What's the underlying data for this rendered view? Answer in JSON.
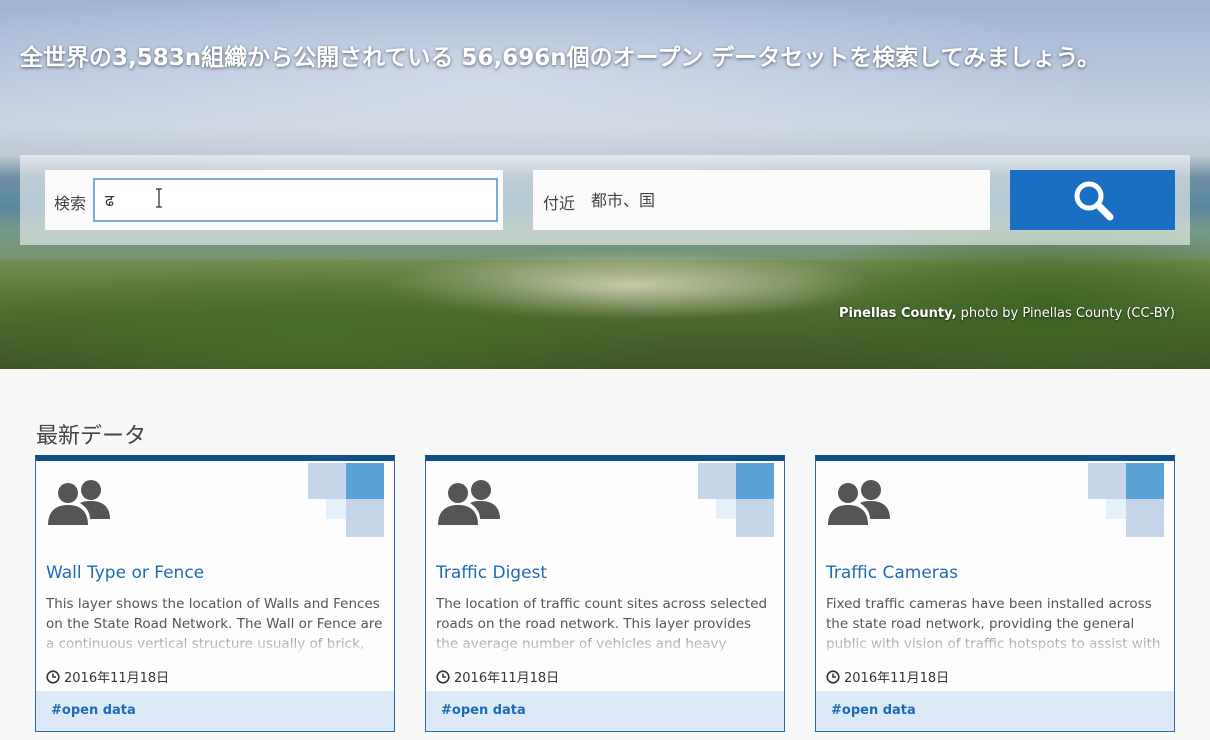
{
  "hero": {
    "title": "全世界の3,583n組織から公開されている 56,696n個のオープン データセットを検索してみましょう。",
    "credit_bold": "Pinellas County,",
    "credit_rest": " photo by Pinellas County (CC-BY)"
  },
  "search": {
    "label": "検索",
    "value": "ढ",
    "near_label": "付近",
    "near_placeholder": "都市、国",
    "button_icon": "search-icon"
  },
  "recent": {
    "title": "最新データ",
    "cards": [
      {
        "title": "Wall Type or Fence",
        "description": "This layer shows the location of Walls and Fences on the State Road Network. The Wall or Fence are a continuous vertical structure usually of brick,",
        "date": "2016年11月18日",
        "tag": "#open data",
        "icon": "group-icon"
      },
      {
        "title": "Traffic Digest",
        "description": "The location of traffic count sites across selected roads on the road network. This layer provides the average number of vehicles and heavy vehicles for",
        "date": "2016年11月18日",
        "tag": "#open data",
        "icon": "group-icon"
      },
      {
        "title": "Traffic Cameras",
        "description": "Fixed traffic cameras have been installed across the state road network, providing the general public with vision of traffic hotspots to assist with",
        "date": "2016年11月18日",
        "tag": "#open data",
        "icon": "group-icon"
      }
    ]
  },
  "colors": {
    "accent": "#1a6fc2",
    "card_border": "#114f88",
    "footer_bg": "#dceaf7",
    "corner_dark": "#5aa3d9",
    "corner_light": "#c5d6ea",
    "corner_pale": "#e4f0fa"
  }
}
